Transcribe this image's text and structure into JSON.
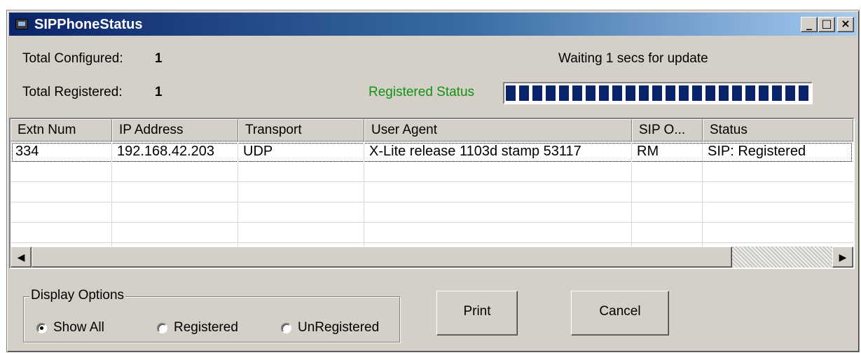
{
  "window": {
    "title": "SIPPhoneStatus",
    "controls": {
      "minimize": "_",
      "maximize": "□",
      "close": "×"
    }
  },
  "summary": {
    "total_configured_label": "Total Configured:",
    "total_configured_value": "1",
    "total_registered_label": "Total Registered:",
    "total_registered_value": "1",
    "waiting_text": "Waiting 1 secs for update",
    "registered_status_label": "Registered Status",
    "progress_fraction": 1.0
  },
  "table": {
    "columns": [
      "Extn Num",
      "IP Address",
      "Transport",
      "User Agent",
      "SIP O...",
      "Status"
    ],
    "rows": [
      [
        "334",
        "192.168.42.203",
        "UDP",
        "X-Lite release 1103d stamp 53117",
        "RM",
        "SIP: Registered"
      ]
    ]
  },
  "display_options": {
    "title": "Display Options",
    "options": [
      "Show All",
      "Registered",
      "UnRegistered"
    ],
    "selected": "Show All"
  },
  "buttons": {
    "print": "Print",
    "cancel": "Cancel"
  },
  "colors": {
    "title_gradient_start": "#0a246a",
    "title_gradient_end": "#a6caf0",
    "registered_status": "#129212",
    "progress": "#0a246a",
    "dialog": "#d4d0c8"
  },
  "icons": {
    "app": "app-window-icon",
    "scroll_left": "arrow-left-icon",
    "scroll_right": "arrow-right-icon"
  }
}
